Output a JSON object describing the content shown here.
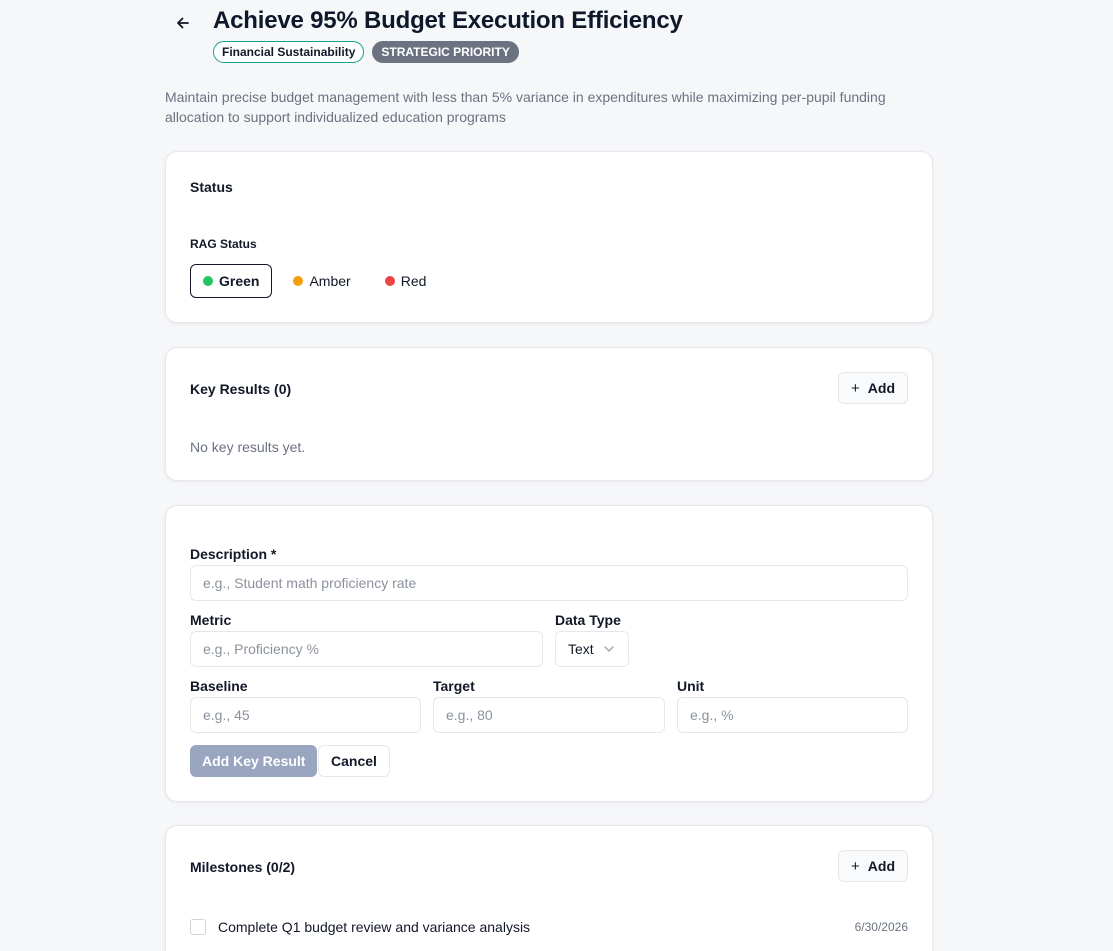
{
  "header": {
    "title": "Achieve 95% Budget Execution Efficiency",
    "badges": [
      "Financial Sustainability",
      "STRATEGIC PRIORITY"
    ],
    "description": "Maintain precise budget management with less than 5% variance in expenditures while maximizing per-pupil funding allocation to support individualized education programs"
  },
  "status": {
    "title": "Status",
    "rag_label": "RAG Status",
    "options": [
      {
        "label": "Green",
        "color": "#22c55e",
        "selected": true
      },
      {
        "label": "Amber",
        "color": "#f59e0b",
        "selected": false
      },
      {
        "label": "Red",
        "color": "#ef4444",
        "selected": false
      }
    ]
  },
  "key_results": {
    "title": "Key Results (0)",
    "add_label": "Add",
    "empty_text": "No key results yet."
  },
  "form": {
    "description_label": "Description *",
    "description_placeholder": "e.g., Student math proficiency rate",
    "metric_label": "Metric",
    "metric_placeholder": "e.g., Proficiency %",
    "data_type_label": "Data Type",
    "data_type_value": "Text",
    "baseline_label": "Baseline",
    "baseline_placeholder": "e.g., 45",
    "target_label": "Target",
    "target_placeholder": "e.g., 80",
    "unit_label": "Unit",
    "unit_placeholder": "e.g., %",
    "submit_label": "Add Key Result",
    "cancel_label": "Cancel"
  },
  "milestones": {
    "title": "Milestones (0/2)",
    "add_label": "Add",
    "items": [
      {
        "text": "Complete Q1 budget review and variance analysis",
        "date": "6/30/2026"
      }
    ]
  }
}
